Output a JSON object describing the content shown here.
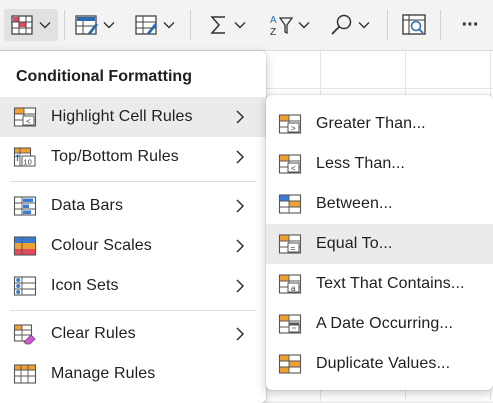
{
  "toolbar": {
    "buttons": [
      {
        "name": "conditional-formatting-icon"
      },
      {
        "name": "format-as-table-icon"
      },
      {
        "name": "cell-styles-icon"
      },
      {
        "name": "autosum-icon"
      },
      {
        "name": "sort-filter-icon"
      },
      {
        "name": "find-select-icon"
      },
      {
        "name": "analyse-data-icon"
      },
      {
        "name": "more-options-icon"
      }
    ],
    "more_glyph": "···",
    "accent_colors": {
      "red": "#c0392b",
      "blue": "#2b6cb0",
      "orange": "#f0a030"
    }
  },
  "menu": {
    "title": "Conditional Formatting",
    "items": [
      {
        "label": "Highlight Cell Rules",
        "icon": "highlight-cell-rules-icon",
        "has_submenu": true
      },
      {
        "label": "Top/Bottom Rules",
        "icon": "top-bottom-rules-icon",
        "has_submenu": true
      },
      {
        "label": "Data Bars",
        "icon": "data-bars-icon",
        "has_submenu": true
      },
      {
        "label": "Colour Scales",
        "icon": "colour-scales-icon",
        "has_submenu": true
      },
      {
        "label": "Icon Sets",
        "icon": "icon-sets-icon",
        "has_submenu": true
      },
      {
        "label": "Clear Rules",
        "icon": "clear-rules-icon",
        "has_submenu": true
      },
      {
        "label": "Manage Rules",
        "icon": "manage-rules-icon",
        "has_submenu": false
      }
    ],
    "top_bottom_icon_text": "10"
  },
  "submenu": {
    "items": [
      {
        "label": "Greater Than...",
        "icon": "greater-than-icon",
        "glyph": ">"
      },
      {
        "label": "Less Than...",
        "icon": "less-than-icon",
        "glyph": "<"
      },
      {
        "label": "Between...",
        "icon": "between-icon",
        "glyph": ""
      },
      {
        "label": "Equal To...",
        "icon": "equal-to-icon",
        "glyph": "="
      },
      {
        "label": "Text That Contains...",
        "icon": "text-contains-icon",
        "glyph": "a"
      },
      {
        "label": "A Date Occurring...",
        "icon": "date-occurring-icon",
        "glyph": ""
      },
      {
        "label": "Duplicate Values...",
        "icon": "duplicate-values-icon",
        "glyph": ""
      }
    ]
  }
}
